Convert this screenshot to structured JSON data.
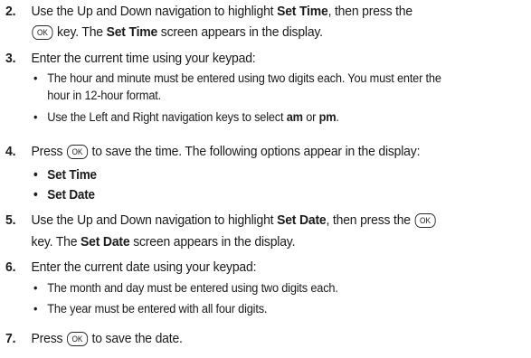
{
  "key_label": "OK",
  "steps": [
    {
      "num": "2.",
      "p1": "Use the Up and Down navigation to highlight ",
      "b1": "Set Time",
      "p2": ", then press the",
      "p3": " key. The ",
      "b2": "Set Time",
      "p4": " screen appears in the display."
    },
    {
      "num": "3.",
      "text": "Enter the current time using your keypad:",
      "bullets": [
        {
          "line1": "The hour and minute must be entered using two digits each. You must enter the",
          "line2": "hour in 12-hour format."
        },
        {
          "p1": "Use the Left and Right navigation keys to select ",
          "b1": "am",
          "p2": " or ",
          "b2": "pm",
          "p3": "."
        }
      ]
    },
    {
      "num": "4.",
      "p1": "Press ",
      "p2": " to save the time. The following options appear in the display:",
      "bullets": [
        "Set Time",
        "Set Date"
      ]
    },
    {
      "num": "5.",
      "p1": "Use the Up and Down navigation to highlight ",
      "b1": "Set Date",
      "p2": ", then press the ",
      "p3": "key. The ",
      "b2": "Set Date",
      "p4": " screen appears in the display."
    },
    {
      "num": "6.",
      "text": "Enter the current date using your keypad:",
      "bullets": [
        "The month and day must be entered using two digits each.",
        "The year must be entered with all four digits."
      ]
    },
    {
      "num": "7.",
      "p1": "Press ",
      "p2": " to save the date."
    }
  ]
}
